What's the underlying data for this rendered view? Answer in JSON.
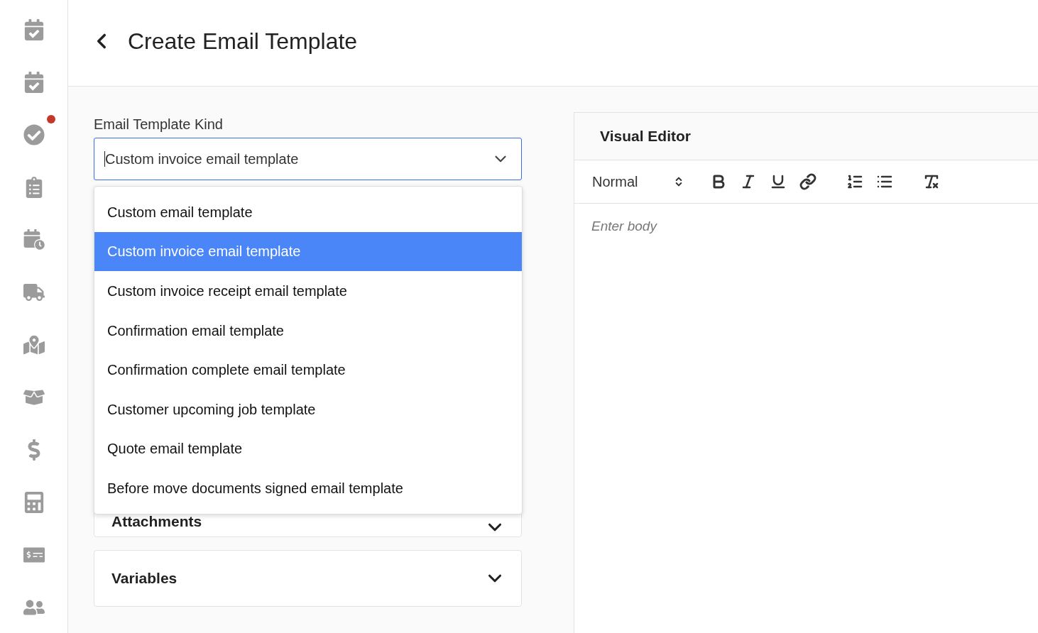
{
  "header": {
    "title": "Create Email Template"
  },
  "sidebar": {
    "items": [
      {
        "notification": false
      },
      {
        "notification": false
      },
      {
        "notification": true
      },
      {
        "notification": false
      },
      {
        "notification": false
      },
      {
        "notification": false
      },
      {
        "notification": false
      },
      {
        "notification": false
      },
      {
        "notification": false
      },
      {
        "notification": false
      },
      {
        "notification": false
      },
      {
        "notification": false
      }
    ]
  },
  "form": {
    "kind_label": "Email Template Kind",
    "kind_select": {
      "value": "Custom invoice email template",
      "expanded": true
    },
    "options": [
      {
        "label": "Custom email template",
        "selected": false
      },
      {
        "label": "Custom invoice email template",
        "selected": true
      },
      {
        "label": "Custom invoice receipt email template",
        "selected": false
      },
      {
        "label": "Confirmation email template",
        "selected": false
      },
      {
        "label": "Confirmation complete email template",
        "selected": false
      },
      {
        "label": "Customer upcoming job template",
        "selected": false
      },
      {
        "label": "Quote email template",
        "selected": false
      },
      {
        "label": "Before move documents signed email template",
        "selected": false
      }
    ],
    "sections": [
      {
        "title": "Attachments",
        "expanded": false
      },
      {
        "title": "Variables",
        "expanded": false
      }
    ]
  },
  "editor": {
    "title": "Visual Editor",
    "format": "Normal",
    "placeholder": "Enter body"
  }
}
